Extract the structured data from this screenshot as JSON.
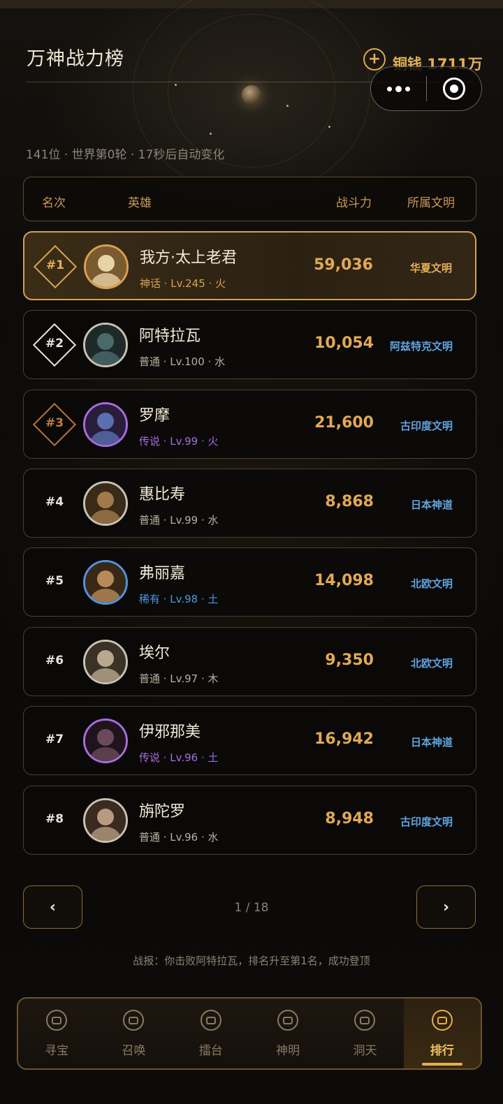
{
  "page": {
    "title": "万神战力榜",
    "subinfo": "141位 · 世界第0轮 · 17秒后自动变化"
  },
  "currency": {
    "label": "铜钱 1711万",
    "add_icon": "plus-circle-icon"
  },
  "capsule": {
    "more_icon": "more-dots-icon",
    "close_icon": "target-close-icon"
  },
  "table_header": {
    "rank": "名次",
    "hero": "英雄",
    "power": "战斗力",
    "civilization": "所属文明"
  },
  "rows": [
    {
      "rank": "#1",
      "name": "我方·太上老君",
      "meta": "神话 · Lv.245 · 火",
      "power": "59,036",
      "civ": "华夏文明",
      "rarity_color": "#d9a24f",
      "civ_color": "#e3b055",
      "rank_style": "gold"
    },
    {
      "rank": "#2",
      "name": "阿特拉瓦",
      "meta": "普通 · Lv.100 · 水",
      "power": "10,054",
      "civ": "阿兹特克文明",
      "rarity_color": "#b9b0a0",
      "civ_color": "#5fa3e0",
      "rank_style": "silver"
    },
    {
      "rank": "#3",
      "name": "罗摩",
      "meta": "传说 · Lv.99 · 火",
      "power": "21,600",
      "civ": "古印度文明",
      "rarity_color": "#a66ce0",
      "civ_color": "#5fa3e0",
      "rank_style": "bronze"
    },
    {
      "rank": "#4",
      "name": "惠比寿",
      "meta": "普通 · Lv.99 · 水",
      "power": "8,868",
      "civ": "日本神道",
      "rarity_color": "#b9b0a0",
      "civ_color": "#5fa3e0",
      "rank_style": "plain"
    },
    {
      "rank": "#5",
      "name": "弗丽嘉",
      "meta": "稀有 · Lv.98 · 土",
      "power": "14,098",
      "civ": "北欧文明",
      "rarity_color": "#4f94e0",
      "civ_color": "#5fa3e0",
      "rank_style": "plain"
    },
    {
      "rank": "#6",
      "name": "埃尔",
      "meta": "普通 · Lv.97 · 木",
      "power": "9,350",
      "civ": "北欧文明",
      "rarity_color": "#b9b0a0",
      "civ_color": "#5fa3e0",
      "rank_style": "plain"
    },
    {
      "rank": "#7",
      "name": "伊邪那美",
      "meta": "传说 · Lv.96 · 土",
      "power": "16,942",
      "civ": "日本神道",
      "rarity_color": "#a66ce0",
      "civ_color": "#5fa3e0",
      "rank_style": "plain"
    },
    {
      "rank": "#8",
      "name": "旃陀罗",
      "meta": "普通 · Lv.96 · 水",
      "power": "8,948",
      "civ": "古印度文明",
      "rarity_color": "#b9b0a0",
      "civ_color": "#5fa3e0",
      "rank_style": "plain"
    }
  ],
  "pager": {
    "prev": "‹",
    "next": "›",
    "text": "1 / 18"
  },
  "battle_report": "战报：你击败阿特拉瓦，排名升至第1名，成功登顶",
  "tabs": [
    {
      "label": "寻宝",
      "icon": "treasure-icon",
      "active": false
    },
    {
      "label": "召唤",
      "icon": "summon-icon",
      "active": false
    },
    {
      "label": "擂台",
      "icon": "arena-icon",
      "active": false
    },
    {
      "label": "神明",
      "icon": "deity-icon",
      "active": false
    },
    {
      "label": "洞天",
      "icon": "cave-icon",
      "active": false
    },
    {
      "label": "排行",
      "icon": "ranking-icon",
      "active": true
    }
  ]
}
